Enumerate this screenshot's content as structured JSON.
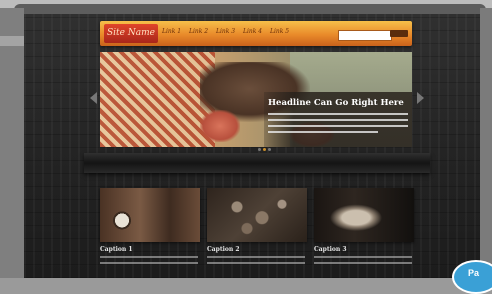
{
  "site": {
    "logo": "Site Name",
    "nav_links": [
      "Link 1",
      "Link 2",
      "Link 3",
      "Link 4",
      "Link 5"
    ],
    "search_placeholder": ""
  },
  "hero": {
    "headline": "Headline Can Go Right Here",
    "active_slide": 2,
    "slide_count": 3
  },
  "features": [
    {
      "caption": "Caption 1"
    },
    {
      "caption": "Caption 2"
    },
    {
      "caption": "Caption 3"
    }
  ],
  "badge": {
    "label": "Pa"
  },
  "colors": {
    "nav_orange": "#e98a2a",
    "logo_red": "#c0331f",
    "page_bg": "#2a2a2a",
    "badge_blue": "#3aa0d6"
  }
}
